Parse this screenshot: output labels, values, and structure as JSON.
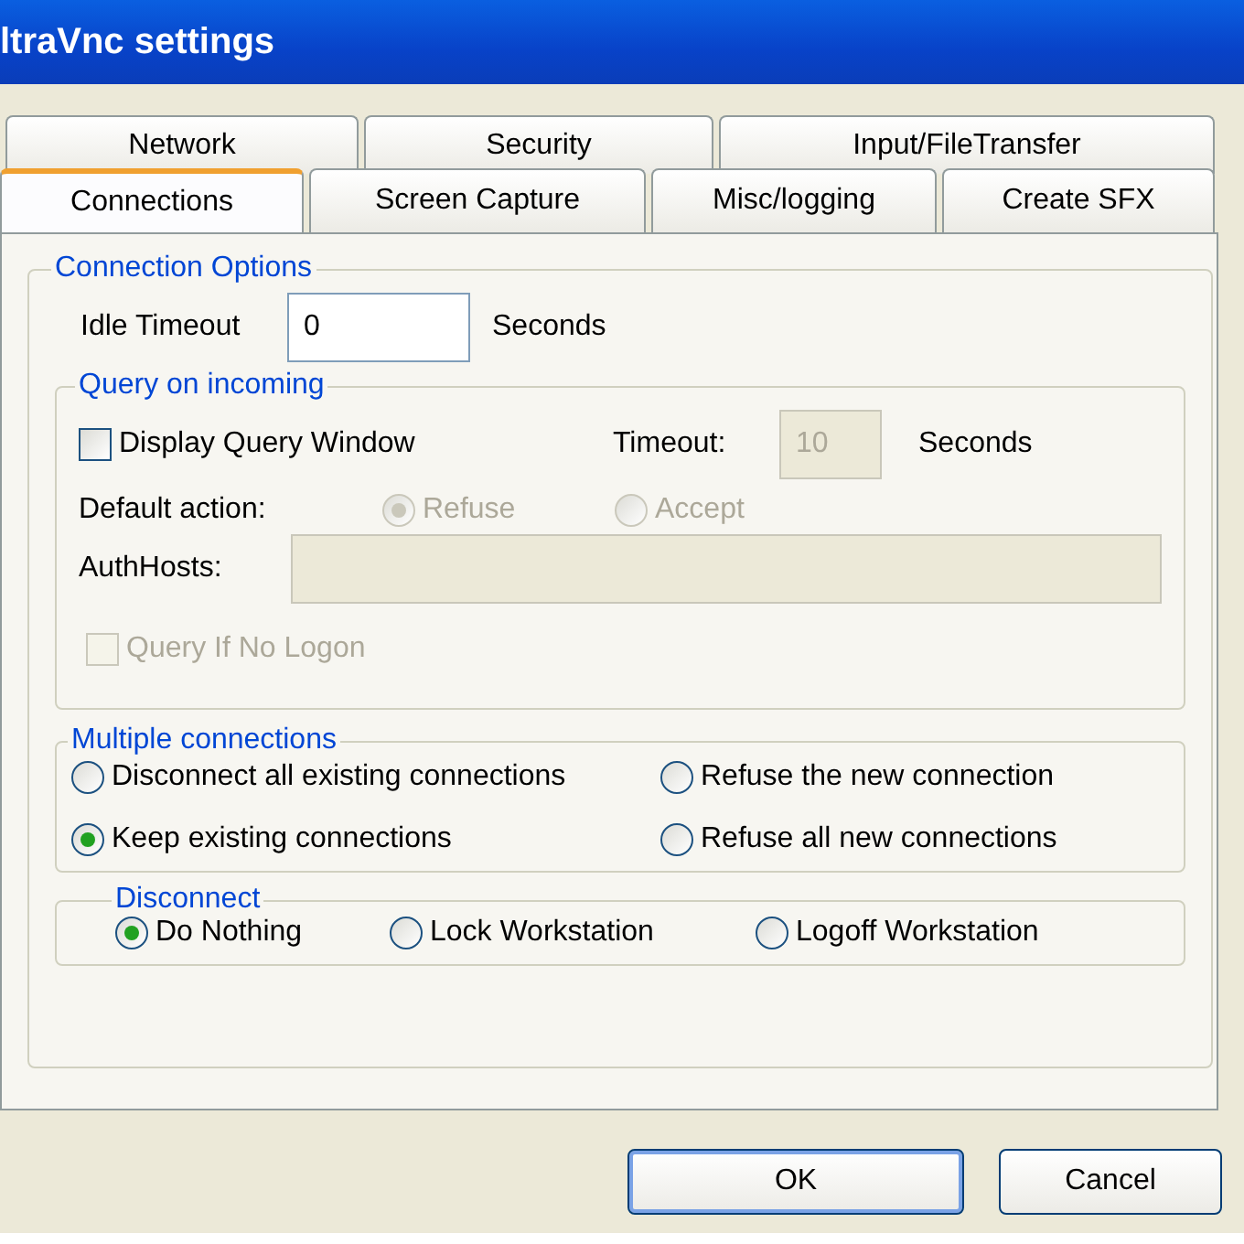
{
  "window": {
    "title": "ltraVnc settings"
  },
  "tabs": {
    "back_row": [
      {
        "label": "Network",
        "selected": false
      },
      {
        "label": "Security",
        "selected": false
      },
      {
        "label": "Input/FileTransfer",
        "selected": false
      }
    ],
    "front_row": [
      {
        "label": "Connections",
        "selected": true
      },
      {
        "label": "Screen Capture",
        "selected": false
      },
      {
        "label": "Misc/logging",
        "selected": false
      },
      {
        "label": "Create SFX",
        "selected": false
      }
    ]
  },
  "connection_options": {
    "title": "Connection Options",
    "idle_timeout": {
      "label": "Idle Timeout",
      "value": "0",
      "unit": "Seconds"
    },
    "query_on_incoming": {
      "title": "Query on incoming",
      "display_query_window": {
        "label": "Display Query Window",
        "checked": false,
        "disabled": false
      },
      "timeout": {
        "label": "Timeout:",
        "value": "10",
        "unit": "Seconds",
        "disabled": true
      },
      "default_action": {
        "label": "Default action:",
        "options": [
          {
            "label": "Refuse",
            "selected": true,
            "disabled": true
          },
          {
            "label": "Accept",
            "selected": false,
            "disabled": true
          }
        ]
      },
      "auth_hosts": {
        "label": "AuthHosts:",
        "disabled": true
      },
      "query_if_no_logon": {
        "label": "Query If No Logon",
        "checked": false,
        "disabled": true
      }
    },
    "multiple_connections": {
      "title": "Multiple connections",
      "options": [
        {
          "label": "Disconnect all existing connections",
          "selected": false
        },
        {
          "label": "Refuse the new connection",
          "selected": false
        },
        {
          "label": "Keep existing connections",
          "selected": true
        },
        {
          "label": "Refuse all new connections",
          "selected": false
        }
      ]
    },
    "disconnect": {
      "title": "Disconnect",
      "options": [
        {
          "label": "Do Nothing",
          "selected": true
        },
        {
          "label": "Lock Workstation",
          "selected": false
        },
        {
          "label": "Logoff Workstation",
          "selected": false
        }
      ]
    }
  },
  "buttons": [
    {
      "label": "OK",
      "default": true
    },
    {
      "label": "Cancel",
      "default": false
    }
  ]
}
